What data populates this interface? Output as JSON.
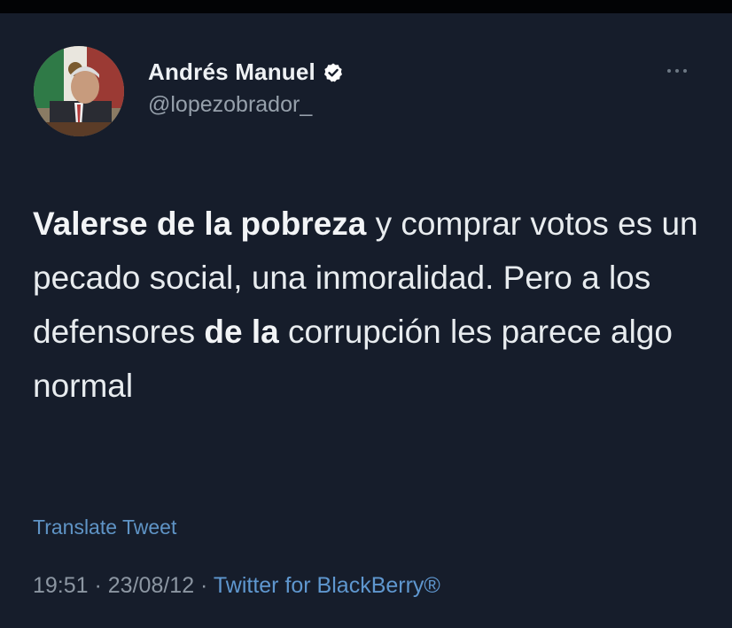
{
  "author": {
    "display_name": "Andrés Manuel",
    "handle": "@lopezobrador_",
    "verified": true
  },
  "tweet": {
    "bold_1": "Valerse de la pobreza",
    "text_1": " y comprar votos es un pecado social, una inmoralidad. Pero a los defensores ",
    "bold_2": "de la",
    "text_2": " corrupción les parece algo normal"
  },
  "translate_label": "Translate Tweet",
  "meta": {
    "time": "19:51",
    "separator": " · ",
    "date": "23/08/12",
    "source": "Twitter for BlackBerry®"
  },
  "colors": {
    "background": "#161d2b",
    "link": "#5f97cf",
    "muted_text": "#8c96a2",
    "verified_badge": "#ffffff"
  },
  "icons": [
    "more-options-icon",
    "verified-badge-icon"
  ]
}
